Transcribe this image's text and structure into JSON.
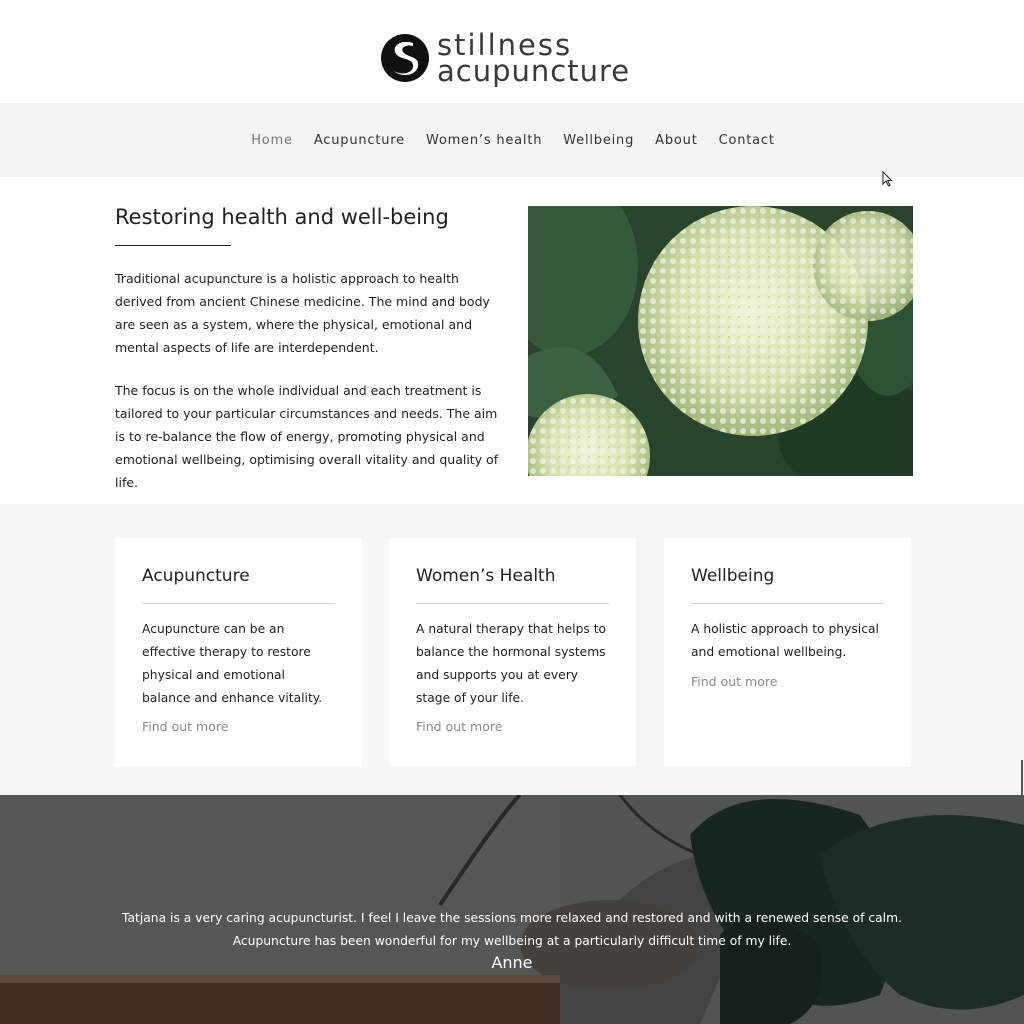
{
  "brand": {
    "line1": "stillness",
    "line2": "acupuncture",
    "logo_icon": "stillness-s-logo"
  },
  "nav": {
    "items": [
      {
        "label": "Home",
        "active": true
      },
      {
        "label": "Acupuncture"
      },
      {
        "label": "Women’s health"
      },
      {
        "label": "Wellbeing"
      },
      {
        "label": "About"
      },
      {
        "label": "Contact"
      }
    ]
  },
  "intro": {
    "title": "Restoring health and well-being",
    "paragraphs": [
      "Traditional acupuncture is a holistic approach to health derived from ancient Chinese medicine. The mind and body are seen as a system, where the physical, emotional and mental aspects of life are interdependent.",
      "The focus is on the whole individual and each treatment is tailored to your particular circumstances and needs. The aim is to re-balance the flow of energy, promoting physical and emotional wellbeing, optimising overall vitality and quality of life."
    ]
  },
  "cards": [
    {
      "title": "Acupuncture",
      "text": "Acupuncture can be an effective therapy to restore physical and emotional balance and enhance vitality.",
      "link": "Find out more"
    },
    {
      "title": "Women’s Health",
      "text": "A natural therapy that helps to balance the hormonal systems and supports you at every stage of your life.",
      "link": "Find out more"
    },
    {
      "title": "Wellbeing",
      "text": "A holistic approach to physical and emotional wellbeing.",
      "link": "Find out more"
    }
  ],
  "testimonial": {
    "quote": "Tatjana is a very caring acupuncturist. I feel I leave the sessions more relaxed and restored and with a renewed sense of calm. Acupuncture has been wonderful for my wellbeing at a particularly difficult time of my life.",
    "author": "Anne"
  },
  "colors": {
    "nav_bg": "#f4f4f4",
    "band_bg": "#f7f7f7",
    "link_gray": "#8a8a8a",
    "testimonial_overlay": "#585b59"
  }
}
